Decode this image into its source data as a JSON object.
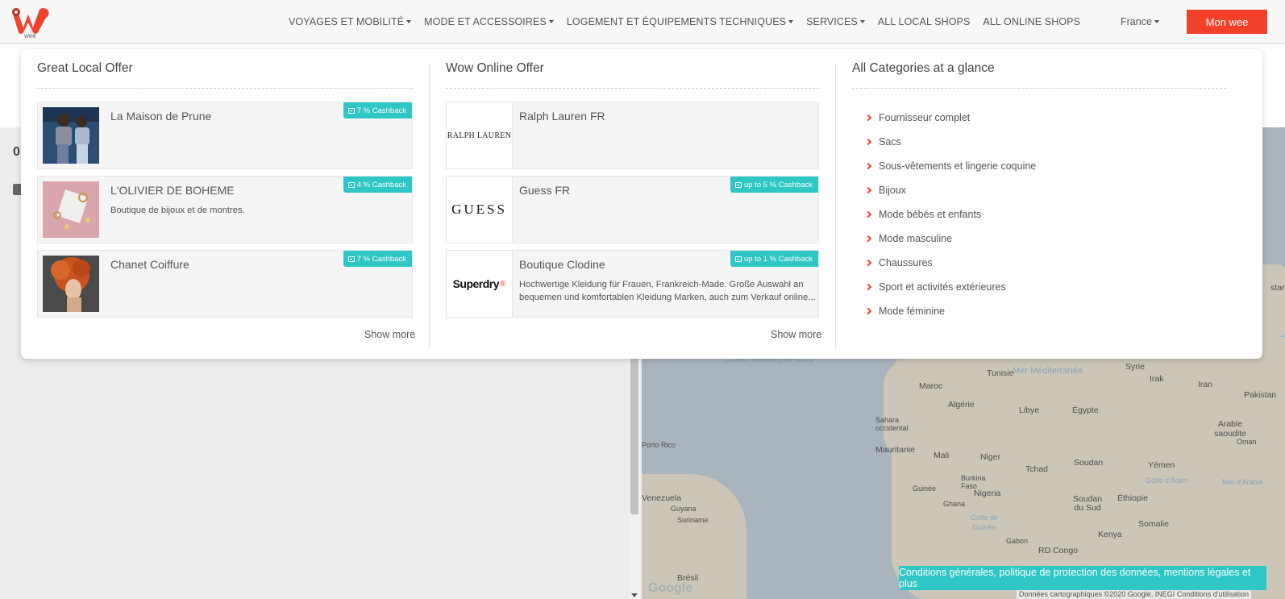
{
  "header": {
    "logo_text": "wee",
    "nav": [
      {
        "label": "VOYAGES ET MOBILITÉ",
        "dropdown": true
      },
      {
        "label": "MODE ET ACCESSOIRES",
        "dropdown": true
      },
      {
        "label": "LOGEMENT ET ÉQUIPEMENTS TECHNIQUES",
        "dropdown": true
      },
      {
        "label": "SERVICES",
        "dropdown": true
      },
      {
        "label": "ALL LOCAL SHOPS",
        "dropdown": false
      },
      {
        "label": "ALL ONLINE SHOPS",
        "dropdown": false
      }
    ],
    "country": "France",
    "account_button": "Mon wee"
  },
  "colors": {
    "accent": "#f2412a",
    "teal": "#2ec7c5"
  },
  "page": {
    "left_number": "0"
  },
  "menu": {
    "local": {
      "title": "Great Local Offer",
      "shops": [
        {
          "name": "La Maison de Prune",
          "description": "",
          "cashback": "7 % Cashback"
        },
        {
          "name": "L'OLIVIER DE BOHEME",
          "description": "Boutique de bijoux et de montres.",
          "cashback": "4 % Cashback"
        },
        {
          "name": "Chanet Coiffure",
          "description": "",
          "cashback": "7 % Cashback"
        }
      ],
      "show_more": "Show more"
    },
    "online": {
      "title": "Wow Online Offer",
      "shops": [
        {
          "name": "Ralph Lauren FR",
          "logo": "RALPH LAUREN",
          "description": "",
          "cashback": ""
        },
        {
          "name": "Guess FR",
          "logo": "GUESS",
          "description": "",
          "cashback": "up to 5 % Cashback"
        },
        {
          "name": "Boutique Clodine",
          "logo": "Superdry",
          "description": "Hochwertige Kleidung für Frauen, Frankreich-Made. Große Auswahl an bequemen und komfortablen Kleidung Marken, auch zum Verkauf online...",
          "cashback": "up to 1 % Cashback"
        }
      ],
      "show_more": "Show more"
    },
    "categories": {
      "title": "All Categories at a glance",
      "items": [
        "Fournisseur complet",
        "Sacs",
        "Sous-vêtements et lingerie coquine",
        "Bijoux",
        "Mode bébés et enfants",
        "Mode masculine",
        "Chaussures",
        "Sport et activités extérieures",
        "Mode féminine"
      ]
    }
  },
  "map": {
    "labels": [
      "Ocean Atlantique Nord",
      "Tunisie",
      "Mer Méditerranée",
      "Syrie",
      "Irak",
      "Iran",
      "Pakistan",
      "Maroc",
      "Algérie",
      "Libye",
      "Égypte",
      "Sahara occidental",
      "Arabie saoudite",
      "Oman",
      "Mauritanie",
      "Mali",
      "Niger",
      "Tchad",
      "Soudan",
      "Yémen",
      "Porto Rico",
      "Burkina Faso",
      "Guinée",
      "Nigeria",
      "Golfe d'Aden",
      "Mer d'Arabie",
      "Éthiopie",
      "Ghana",
      "Soudan du Sud",
      "Venezuela",
      "Guyana",
      "Suriname",
      "Golfe de Guinée",
      "Somalie",
      "Gabon",
      "Kenya",
      "RD Congo",
      "Brésil",
      "stan"
    ],
    "attribution": "Données cartographiques ©2020 Google, INEGI   Conditions d'utilisation",
    "google": "Google"
  },
  "footer": {
    "terms": "Conditions générales, politique de protection des données, mentions légales et plus"
  }
}
